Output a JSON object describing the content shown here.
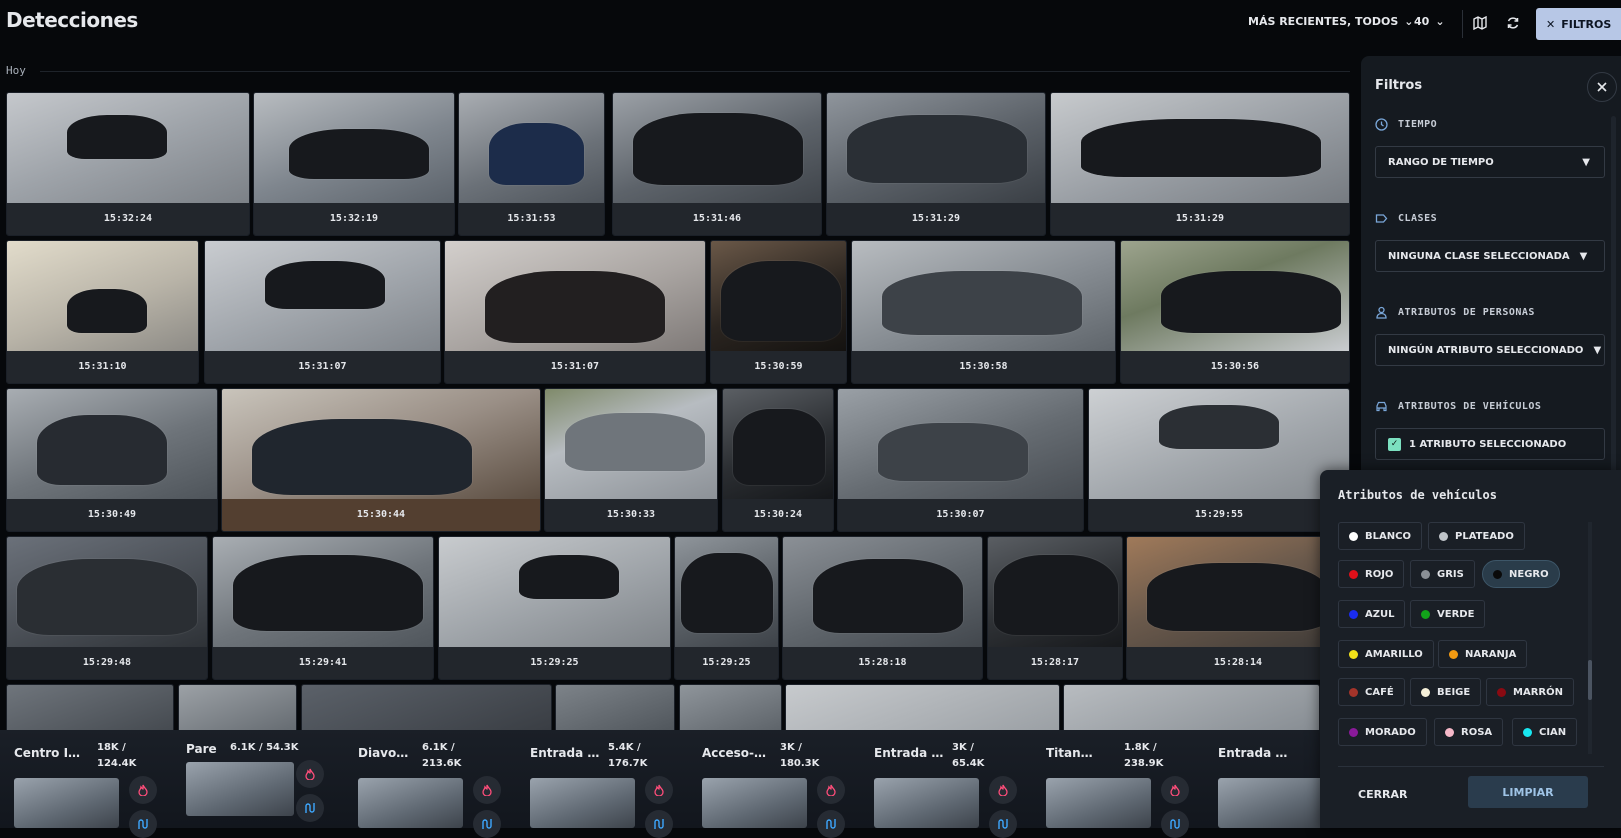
{
  "header": {
    "title": "Detecciones",
    "sort_label": "MÁS RECIENTES, TODOS",
    "count_label": "40",
    "filters_label": "FILTROS"
  },
  "section_label": "Hoy",
  "detections": [
    "15:32:24",
    "15:32:19",
    "15:31:53",
    "15:31:46",
    "15:31:29",
    "15:31:29",
    "15:31:10",
    "15:31:07",
    "15:31:07",
    "15:30:59",
    "15:30:58",
    "15:30:56",
    "15:30:49",
    "15:30:44",
    "15:30:33",
    "15:30:24",
    "15:30:07",
    "15:29:55",
    "15:29:48",
    "15:29:41",
    "15:29:25",
    "15:29:25",
    "15:28:18",
    "15:28:17",
    "15:28:14"
  ],
  "cameras": [
    {
      "name": "Centro I…",
      "stat_a": "18K /",
      "stat_b": "124.4K"
    },
    {
      "name": "Pare",
      "stat_a": "6.1K / 54.3K",
      "stat_b": ""
    },
    {
      "name": "Diavo…",
      "stat_a": "6.1K /",
      "stat_b": "213.6K"
    },
    {
      "name": "Entrada …",
      "stat_a": "5.4K /",
      "stat_b": "176.7K"
    },
    {
      "name": "Acceso-…",
      "stat_a": "3K /",
      "stat_b": "180.3K"
    },
    {
      "name": "Entrada …",
      "stat_a": "3K /",
      "stat_b": "65.4K"
    },
    {
      "name": "Titan…",
      "stat_a": "1.8K /",
      "stat_b": "238.9K"
    },
    {
      "name": "Entrada …",
      "stat_a": "",
      "stat_b": ""
    }
  ],
  "filters": {
    "title": "Filtros",
    "time_section": "TIEMPO",
    "time_value": "RANGO DE TIEMPO",
    "classes_section": "CLASES",
    "classes_value": "NINGUNA CLASE SELECCIONADA",
    "person_section": "ATRIBUTOS DE PERSONAS",
    "person_value": "NINGÚN ATRIBUTO SELECCIONADO",
    "vehicle_section": "ATRIBUTOS DE VEHÍCULOS",
    "vehicle_value": "1 ATRIBUTO SELECCIONADO"
  },
  "vehicle_popup": {
    "title": "Atributos de vehículos",
    "colors": [
      {
        "label": "BLANCO",
        "color": "#ffffff"
      },
      {
        "label": "PLATEADO",
        "color": "#bfc4c9"
      },
      {
        "label": "ROJO",
        "color": "#e0101a"
      },
      {
        "label": "GRIS",
        "color": "#8a8f95"
      },
      {
        "label": "NEGRO",
        "color": "#0a0a0a",
        "selected": true
      },
      {
        "label": "AZUL",
        "color": "#1a2cf0"
      },
      {
        "label": "VERDE",
        "color": "#12a21a"
      },
      {
        "label": "AMARILLO",
        "color": "#f2e21a"
      },
      {
        "label": "NARANJA",
        "color": "#f29a12"
      },
      {
        "label": "CAFÉ",
        "color": "#a4342a"
      },
      {
        "label": "BEIGE",
        "color": "#f5efd8"
      },
      {
        "label": "MARRÓN",
        "color": "#8a0a12"
      },
      {
        "label": "MORADO",
        "color": "#8a1a9a"
      },
      {
        "label": "ROSA",
        "color": "#f5b8c8"
      },
      {
        "label": "CIAN",
        "color": "#18e6f0"
      }
    ],
    "close_label": "CERRAR",
    "clear_label": "LIMPIAR"
  }
}
